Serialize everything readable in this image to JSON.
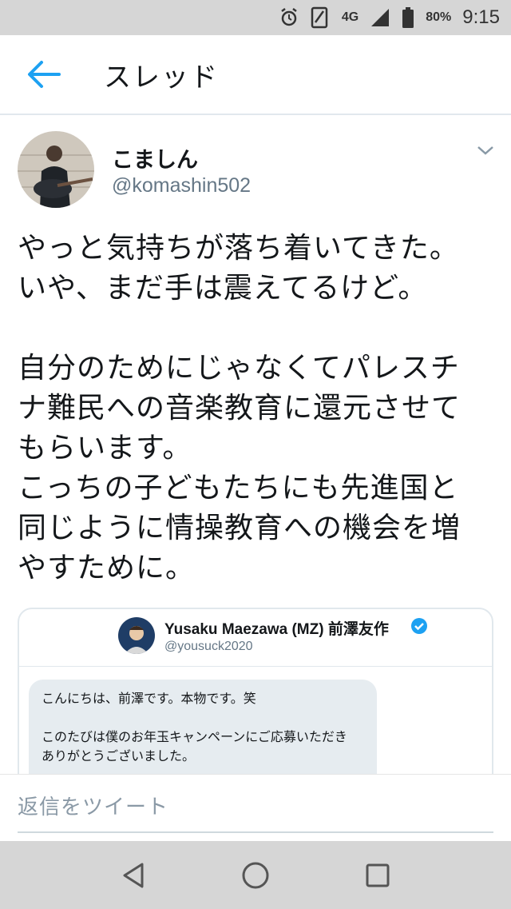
{
  "status_bar": {
    "network": "4G",
    "battery": "80%",
    "time": "9:15",
    "icons": [
      "alarm-icon",
      "sim-icon",
      "signal-icon",
      "battery-icon"
    ]
  },
  "app_bar": {
    "title": "スレッド",
    "back_icon": "back-arrow-icon",
    "accent": "#1da1f2"
  },
  "tweet": {
    "author_name": "こましん",
    "author_handle": "@komashin502",
    "text": "やっと気持ちが落ち着いてきた。\nいや、まだ手は震えてるけど。\n\n自分のためにじゃなくてパレスチ\nナ難民への音楽教育に還元させて\nもらいます。\nこっちの子どもたちにも先進国と\n同じように情操教育への機会を増\nやすために。"
  },
  "quote": {
    "name": "Yusaku Maezawa (MZ) 前澤友作",
    "handle": "@yousuck2020",
    "message_line1": "こんにちは、前澤です。本物です。笑",
    "message_line2": "このたびは僕のお年玉キャンペーンにご応募いただき",
    "message_line3": "ありがとうございました。"
  },
  "reply": {
    "placeholder": "返信をツイート"
  },
  "nav_bar": {
    "icons": [
      "nav-back-icon",
      "nav-home-icon",
      "nav-recents-icon"
    ]
  }
}
